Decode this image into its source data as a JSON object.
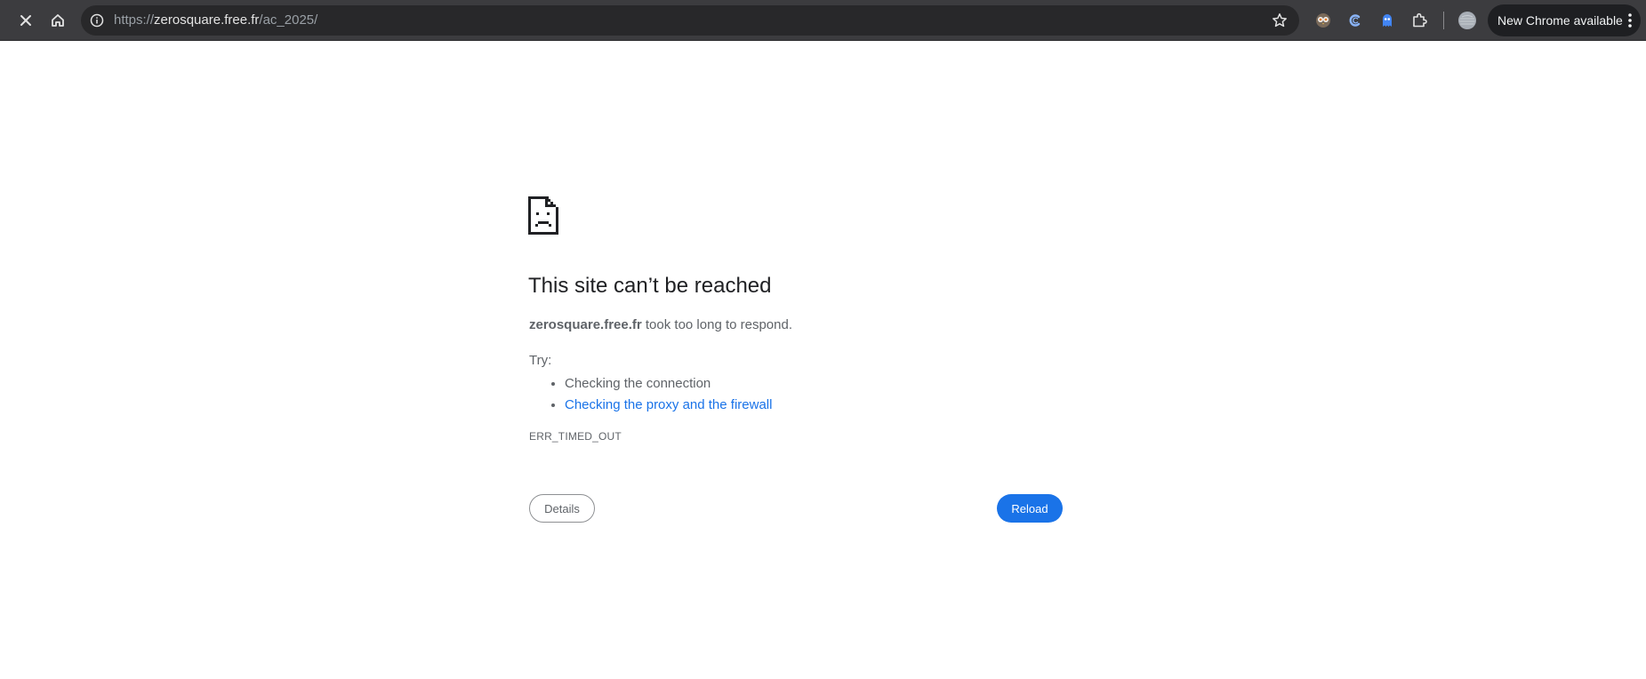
{
  "toolbar": {
    "close_icon": "close-icon",
    "home_icon": "home-icon",
    "omnibox": {
      "info_icon": "info-icon",
      "url_scheme": "https://",
      "url_host": "zerosquare.free.fr",
      "url_path": "/ac_2025/",
      "bookmark_icon": "star-icon"
    },
    "extensions": [
      {
        "name": "extension-owl-icon"
      },
      {
        "name": "extension-c-icon"
      },
      {
        "name": "extension-ghost-icon"
      },
      {
        "name": "extensions-puzzle-icon"
      },
      {
        "name": "profile-avatar-icon"
      }
    ],
    "update_button_label": "New Chrome available",
    "menu_icon": "more-vert-icon"
  },
  "error_page": {
    "icon": "sad-document-icon",
    "title": "This site can’t be reached",
    "host": "zerosquare.free.fr",
    "summary_suffix": " took too long to respond.",
    "try_label": "Try:",
    "suggestions": [
      "Checking the connection",
      "Checking the proxy and the firewall"
    ],
    "error_code": "ERR_TIMED_OUT",
    "details_label": "Details",
    "reload_label": "Reload"
  },
  "colors": {
    "toolbar_bg": "#3c3c3f",
    "omnibox_bg": "#28282a",
    "link": "#1a73e8",
    "reload_bg": "#1a73e8",
    "text_primary": "#202124",
    "text_secondary": "#5f6368"
  }
}
